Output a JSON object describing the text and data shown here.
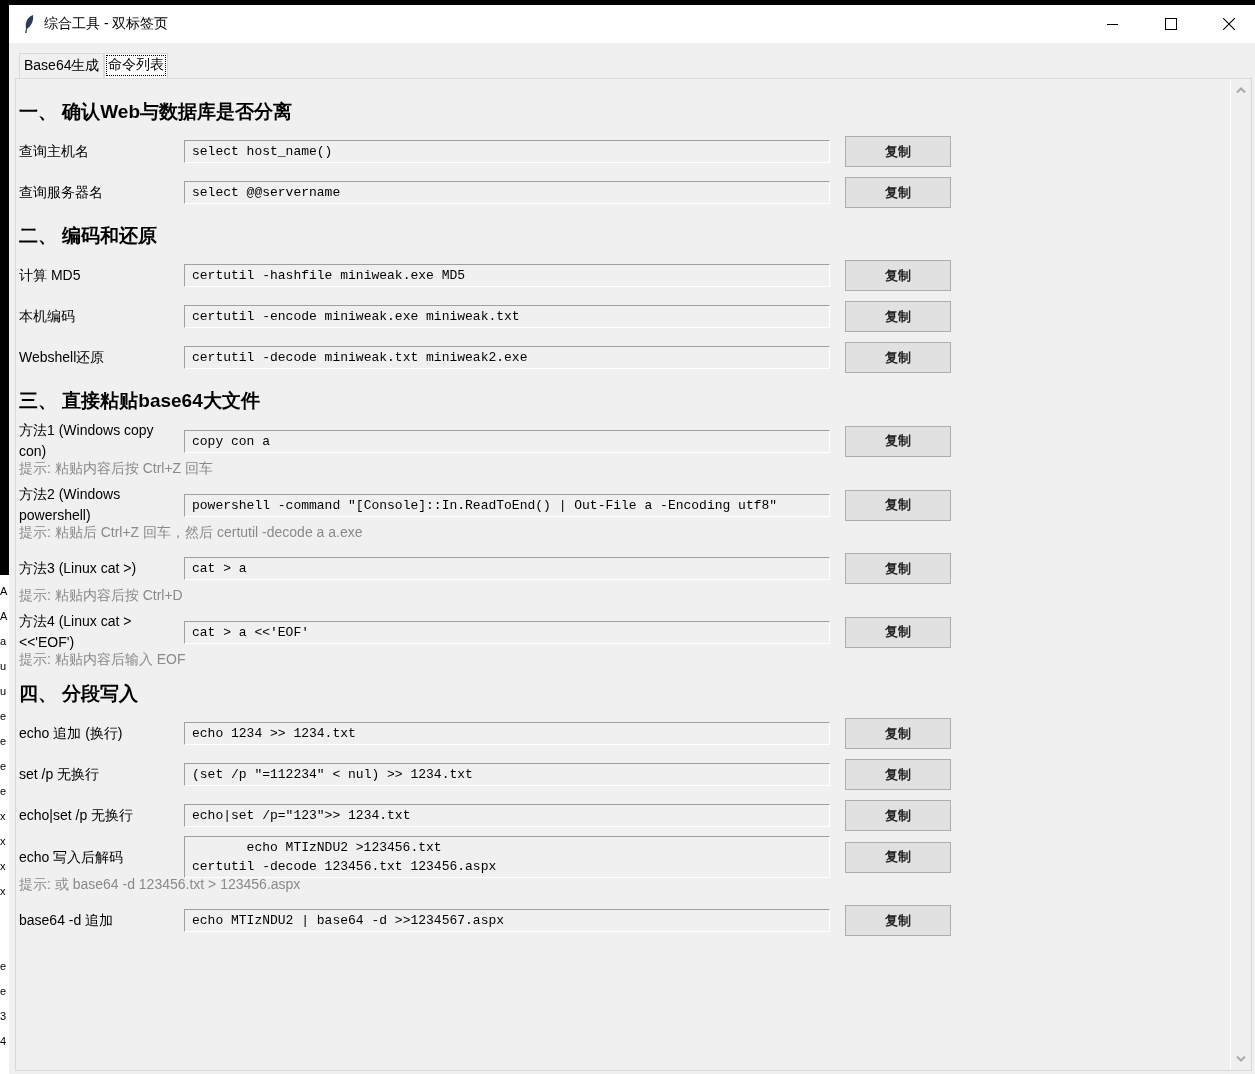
{
  "background_window": {
    "fragments": [
      "A",
      "A",
      "a",
      "u",
      "u",
      "e",
      "e",
      "e",
      "e",
      "x",
      "x",
      "x",
      "x",
      "e",
      "e",
      "3",
      "4"
    ]
  },
  "window": {
    "title": "综合工具 - 双标签页"
  },
  "tabs": [
    {
      "label": "Base64生成",
      "selected": false
    },
    {
      "label": "命令列表",
      "selected": true
    }
  ],
  "sections": [
    {
      "heading": "一、 确认Web与数据库是否分离",
      "rows": [
        {
          "label": "查询主机名",
          "command": "select host_name()",
          "button": "复制"
        },
        {
          "label": "查询服务器名",
          "command": "select @@servername",
          "button": "复制"
        }
      ]
    },
    {
      "heading": "二、 编码和还原",
      "rows": [
        {
          "label": "计算 MD5",
          "command": "certutil -hashfile miniweak.exe MD5",
          "button": "复制"
        },
        {
          "label": "本机编码",
          "command": "certutil -encode miniweak.exe miniweak.txt",
          "button": "复制"
        },
        {
          "label": "Webshell还原",
          "command": "certutil -decode miniweak.txt miniweak2.exe",
          "button": "复制"
        }
      ]
    },
    {
      "heading": "三、 直接粘贴base64大文件",
      "rows": [
        {
          "label": "方法1 (Windows copy con)",
          "command": "copy con a",
          "button": "复制",
          "hint": "提示: 粘贴内容后按 Ctrl+Z 回车"
        },
        {
          "label": "方法2 (Windows powershell)",
          "command": "powershell -command \"[Console]::In.ReadToEnd() | Out-File a -Encoding utf8\"",
          "button": "复制",
          "hint": "提示: 粘贴后 Ctrl+Z 回车，然后 certutil -decode a a.exe"
        },
        {
          "label": "方法3 (Linux cat >)",
          "command": "cat > a",
          "button": "复制",
          "hint": "提示: 粘贴内容后按 Ctrl+D"
        },
        {
          "label": "方法4 (Linux cat > <<'EOF')",
          "command": "cat > a <<'EOF'",
          "button": "复制",
          "hint": "提示: 粘贴内容后输入 EOF"
        }
      ]
    },
    {
      "heading": "四、 分段写入",
      "rows": [
        {
          "label": "echo 追加 (换行)",
          "command": "echo 1234 >> 1234.txt",
          "button": "复制"
        },
        {
          "label": "set /p 无换行",
          "command": "(set /p \"=112234\" < nul) >> 1234.txt",
          "button": "复制"
        },
        {
          "label": "echo|set /p 无换行",
          "command": "echo|set /p=\"123\">> 1234.txt",
          "button": "复制"
        },
        {
          "label": "echo 写入后解码",
          "command": "echo MTIzNDU2 >123456.txt\ncertutil -decode 123456.txt 123456.aspx",
          "button": "复制",
          "hint": "提示: 或 base64 -d 123456.txt > 123456.aspx"
        },
        {
          "label": "base64 -d 追加",
          "command": "echo MTIzNDU2 | base64 -d >>1234567.aspx",
          "button": "复制"
        }
      ]
    }
  ]
}
